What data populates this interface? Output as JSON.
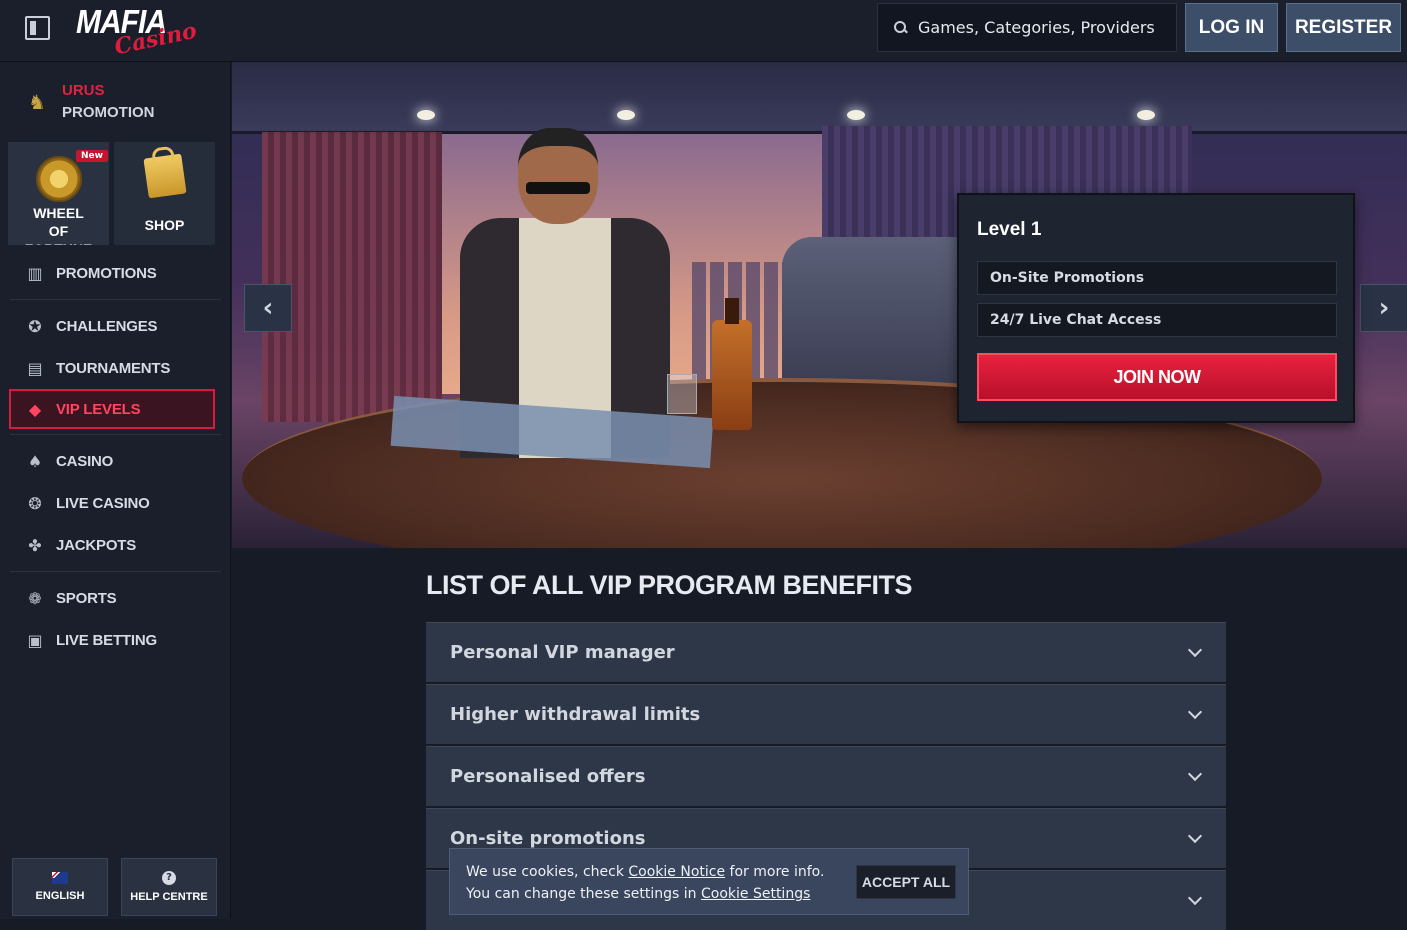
{
  "header": {
    "logo_main": "MAFIA",
    "logo_sub": "Casino",
    "search_placeholder": "Games, Categories, Providers",
    "login_label": "LOG IN",
    "register_label": "REGISTER"
  },
  "sidebar": {
    "promo": {
      "title": "URUS",
      "subtitle": "PROMOTION"
    },
    "tiles": {
      "wheel_label": "WHEEL OF FORTUNE",
      "new_badge": "New",
      "shop_label": "SHOP"
    },
    "group1": [
      {
        "label": "PROMOTIONS",
        "icon": "gift-icon"
      },
      {
        "label": "CHALLENGES",
        "icon": "badge-icon"
      },
      {
        "label": "TOURNAMENTS",
        "icon": "podium-icon"
      },
      {
        "label": "VIP LEVELS",
        "icon": "diamond-icon",
        "active": true
      }
    ],
    "group2": [
      {
        "label": "CASINO",
        "icon": "spade-icon"
      },
      {
        "label": "LIVE CASINO",
        "icon": "chip-icon"
      },
      {
        "label": "JACKPOTS",
        "icon": "clover-icon"
      }
    ],
    "group3": [
      {
        "label": "SPORTS",
        "icon": "ball-icon"
      },
      {
        "label": "LIVE BETTING",
        "icon": "live-icon"
      }
    ],
    "footer": {
      "language_label": "ENGLISH",
      "help_label": "HELP CENTRE"
    }
  },
  "hero": {
    "level": {
      "title": "Level 1",
      "benefits": [
        "On-Site Promotions",
        "24/7 Live Chat Access"
      ],
      "cta": "JOIN NOW"
    }
  },
  "benefits": {
    "title": "LIST OF ALL VIP PROGRAM BENEFITS",
    "items": [
      "Personal VIP manager",
      "Higher withdrawal limits",
      "Personalised offers",
      "On-site promotions",
      ""
    ]
  },
  "cookie": {
    "line1_prefix": "We use cookies, check",
    "line1_link": "Cookie Notice",
    "line1_suffix": "for more info.",
    "line2_prefix": "You can change these settings in",
    "line2_link": "Cookie Settings",
    "accept_label": "ACCEPT ALL"
  },
  "colors": {
    "accent_red": "#e0233f",
    "panel": "#2e3747",
    "background": "#161b26"
  }
}
